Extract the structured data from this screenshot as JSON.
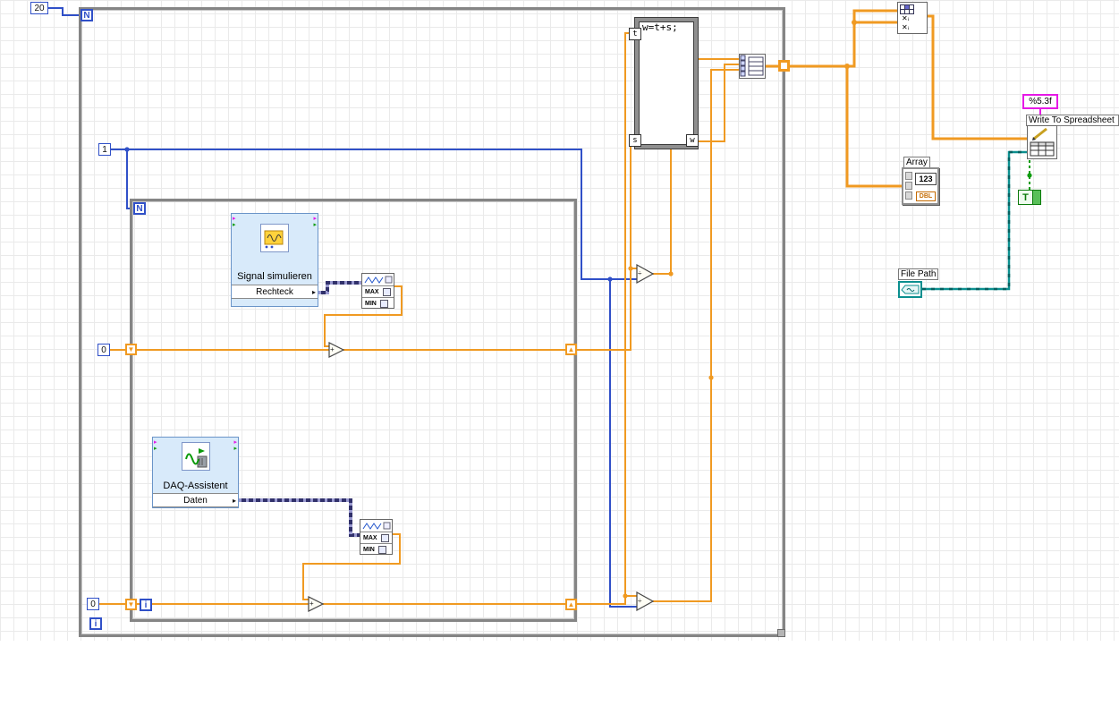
{
  "outer_loop": {
    "count_constant": "20",
    "count_terminal": "N",
    "iteration_terminal": "i"
  },
  "inner_loop": {
    "count_terminal": "N",
    "iteration_terminal": "i",
    "init_constant": "1",
    "shift_init_top": "0",
    "shift_init_bottom": "0"
  },
  "signal_vi": {
    "title": "Signal simulieren",
    "output": "Rechteck"
  },
  "daq_vi": {
    "title": "DAQ-Assistent",
    "output": "Daten"
  },
  "minmax": {
    "max": "MAX",
    "min": "MIN"
  },
  "formula_node": {
    "expression": "w=t+s;",
    "input_top": "t",
    "input_bottom": "s",
    "output": "w"
  },
  "array_indicator": {
    "label": "Array",
    "digits": "123",
    "type": "DBL"
  },
  "write_vi": {
    "label": "Write To Spreadsheet",
    "format_string": "%5.3f"
  },
  "file_path": {
    "label": "File Path"
  },
  "boolean_constant": {
    "value": "T"
  },
  "glyphs": {
    "arrow": "▸",
    "shift_down": "▼",
    "shift_up": "▲",
    "add": "+",
    "divide": "÷",
    "index_row": "✕ᵢ"
  },
  "colors": {
    "orange": "#F09A22",
    "blue": "#3050C8",
    "dyn": "#31316B",
    "teal": "#0B8F8F",
    "green": "#0E9C0E",
    "pink": "#E619E6",
    "exvibg": "#D8EAFA",
    "exvibd": "#6A94C8",
    "loopb": "#858585",
    "grid": "#EAEAEA"
  }
}
